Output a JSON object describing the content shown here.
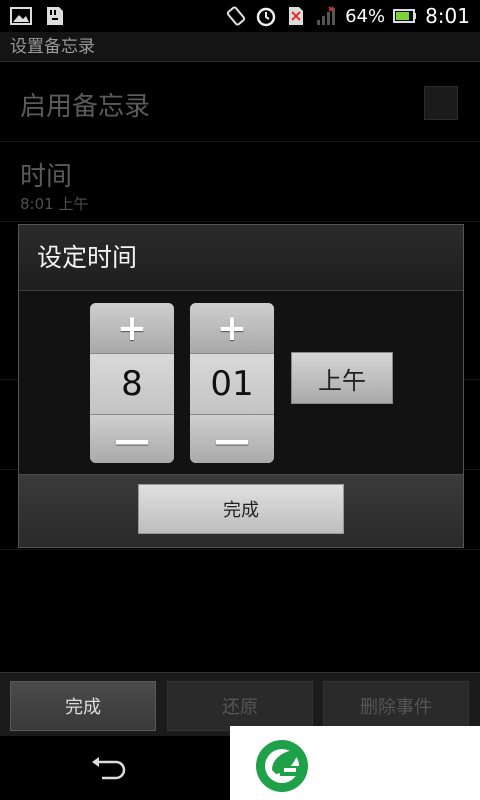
{
  "status": {
    "battery_text": "64%",
    "time": "8:01"
  },
  "screen_title": "设置备忘录",
  "prefs": {
    "enable_label": "启用备忘录",
    "time_label": "时间",
    "time_value": "8:01 上午"
  },
  "dialog": {
    "title": "设定时间",
    "hour": "8",
    "minute": "01",
    "plus": "+",
    "minus": "—",
    "ampm": "上午",
    "done": "完成"
  },
  "bottom_bar": {
    "done": "完成",
    "restore": "还原",
    "delete": "删除事件"
  },
  "icons": {
    "gallery": "image-icon",
    "sd": "sd-card-icon",
    "rotate": "rotate-icon",
    "alarm": "alarm-icon",
    "no-sim": "no-sim-icon",
    "signal": "signal-icon",
    "battery": "battery-icon",
    "back": "back-icon",
    "logo": "leaf-logo-icon"
  },
  "colors": {
    "accent_green": "#1fa14a",
    "battery_green": "#7cd13a"
  }
}
